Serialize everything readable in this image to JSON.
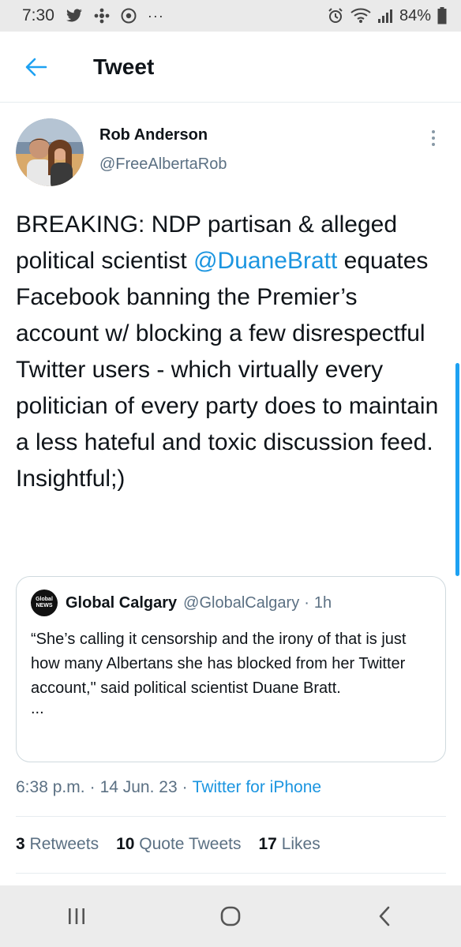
{
  "status_bar": {
    "time": "7:30",
    "more": "···",
    "battery": "84%",
    "icons": [
      "twitter-icon",
      "cbc-icon",
      "chrome-icon",
      "alarm-icon",
      "wifi-icon",
      "signal-icon",
      "battery-icon"
    ]
  },
  "header": {
    "title": "Tweet",
    "back_icon": "back-arrow-icon"
  },
  "author": {
    "name": "Rob Anderson",
    "handle": "@FreeAlbertaRob"
  },
  "tweet": {
    "text_before": "BREAKING: NDP partisan & alleged political scientist ",
    "mention": "@DuaneBratt",
    "text_after": " equates Facebook banning the Premier’s account w/ blocking a few disrespectful Twitter users - which virtually every politician of every party does to maintain a less hateful and toxic  discussion feed. Insightful;)"
  },
  "quote": {
    "logo_line1": "Global",
    "logo_line2": "NEWS",
    "name": "Global Calgary",
    "handle": "@GlobalCalgary",
    "dot": "·",
    "time": "1h",
    "text": "“She’s calling it censorship and the irony of that is just how many Albertans she has blocked from her Twitter account,\" said political scientist Duane Bratt.",
    "ellipsis": "..."
  },
  "meta": {
    "time": "6:38 p.m.",
    "sep": "·",
    "date": "14 Jun. 23",
    "source": "Twitter for iPhone"
  },
  "stats": {
    "retweets_count": "3",
    "retweets_label": "Retweets",
    "quotes_count": "10",
    "quotes_label": "Quote Tweets",
    "likes_count": "17",
    "likes_label": "Likes"
  },
  "colors": {
    "accent": "#1b95e0",
    "secondary_text": "#5b7083",
    "status_bar_bg": "#eaeaea"
  }
}
